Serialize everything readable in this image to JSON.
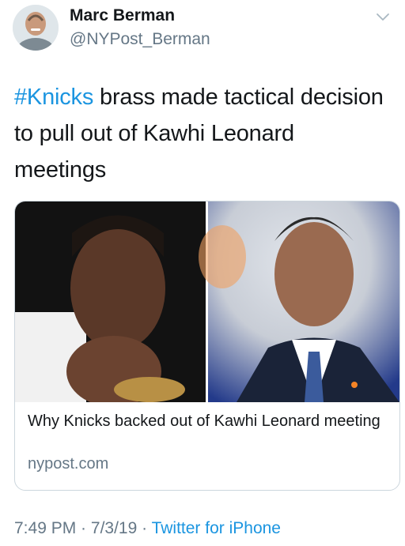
{
  "author": {
    "name": "Marc Berman",
    "handle": "@NYPost_Berman",
    "avatar_icon": "avatar-photo"
  },
  "tweet": {
    "hashtag": "#Knicks",
    "text_rest": " brass made tactical decision to pull out of Kawhi Leonard meetings"
  },
  "card": {
    "title": "Why Knicks backed out of Kawhi Leonard meeting",
    "domain": "nypost.com"
  },
  "meta": {
    "time": "7:49 PM",
    "separator": " · ",
    "date": "7/3/19",
    "separator2": " · ",
    "source": "Twitter for iPhone"
  },
  "colors": {
    "link": "#1b95e0",
    "secondary_text": "#657786",
    "primary_text": "#14171a"
  }
}
